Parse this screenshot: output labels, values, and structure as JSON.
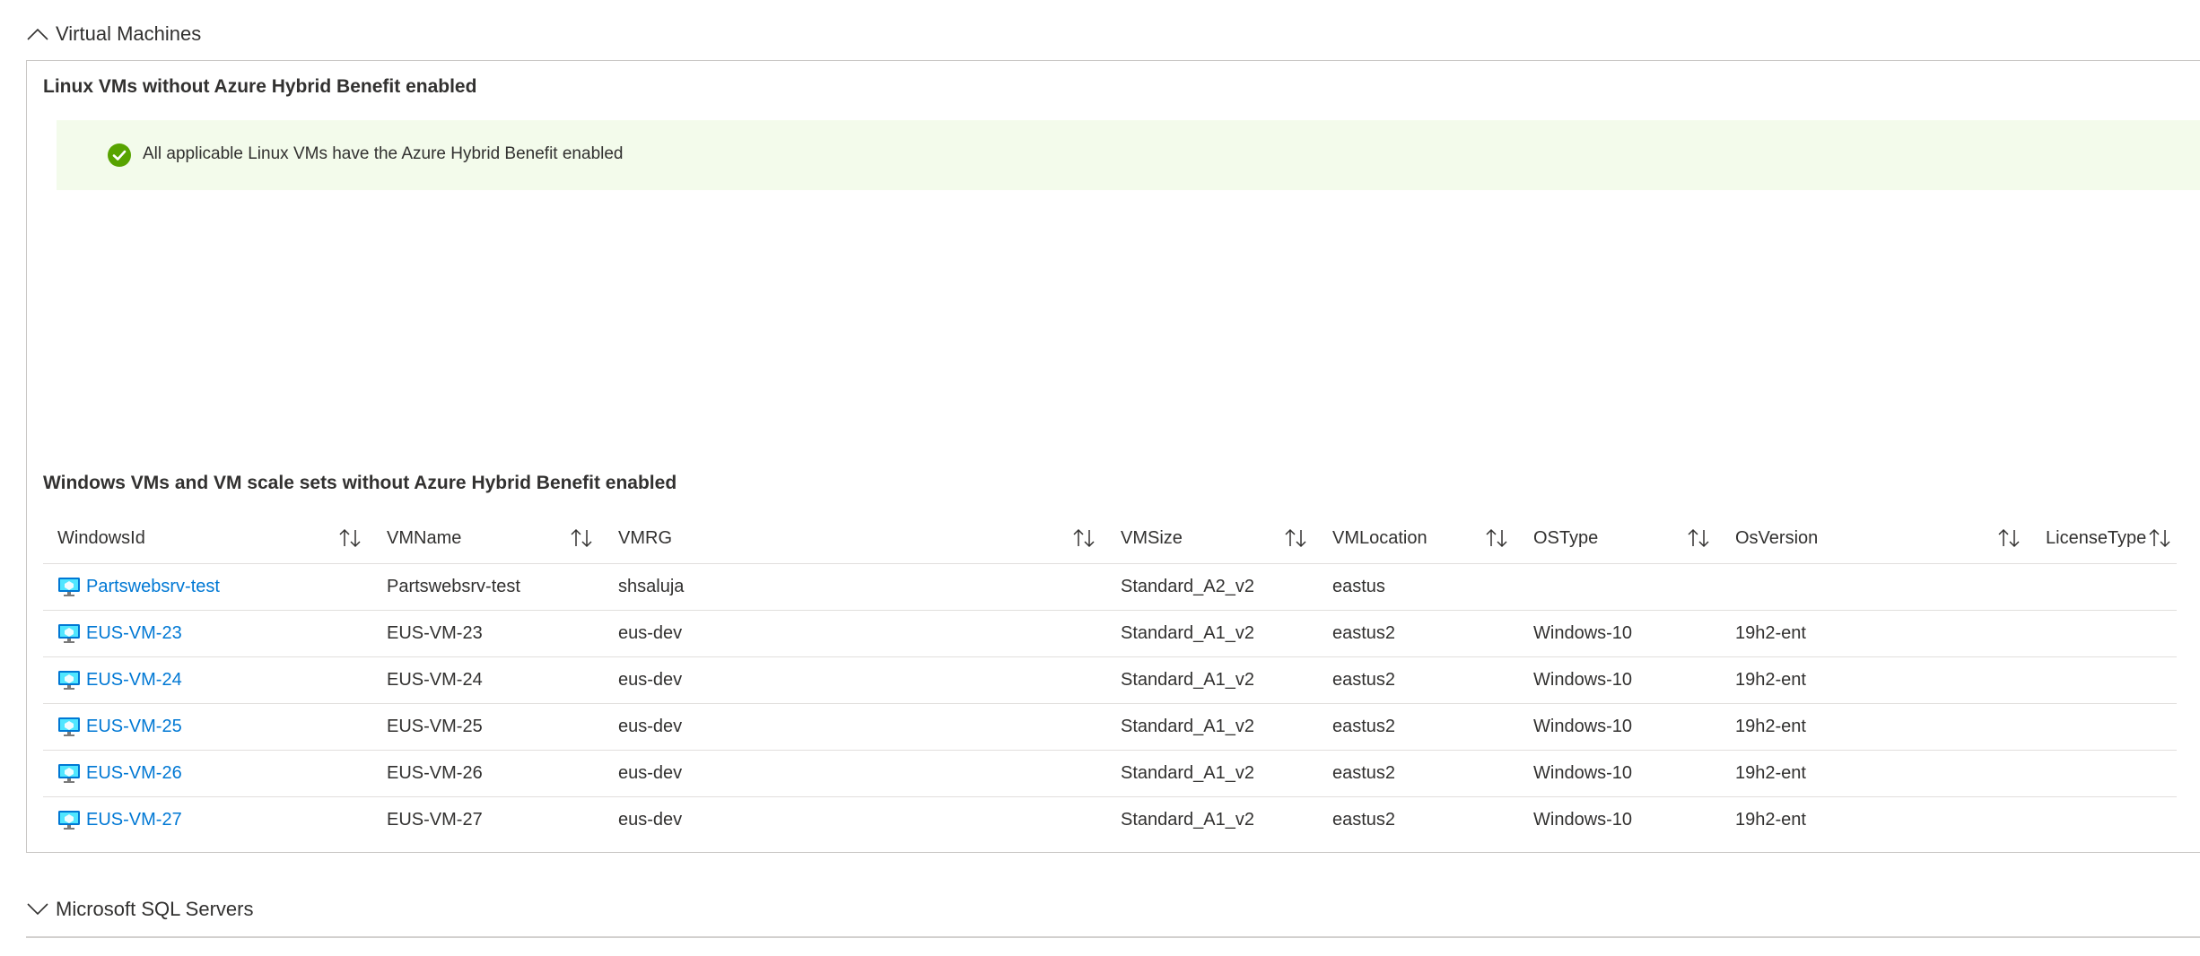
{
  "vm_section": {
    "title": "Virtual Machines",
    "expanded": true
  },
  "linux": {
    "title": "Linux VMs without Azure Hybrid Benefit enabled",
    "success_message": "All applicable Linux VMs have the Azure Hybrid Benefit enabled"
  },
  "windows": {
    "title": "Windows VMs and VM scale sets without Azure Hybrid Benefit enabled",
    "columns": [
      "WindowsId",
      "VMName",
      "VMRG",
      "VMSize",
      "VMLocation",
      "OSType",
      "OsVersion",
      "LicenseType"
    ],
    "rows": [
      {
        "id": "Partswebsrv-test",
        "name": "Partswebsrv-test",
        "rg": "shsaluja",
        "size": "Standard_A2_v2",
        "location": "eastus",
        "ostype": "",
        "osversion": "",
        "license": ""
      },
      {
        "id": "EUS-VM-23",
        "name": "EUS-VM-23",
        "rg": "eus-dev",
        "size": "Standard_A1_v2",
        "location": "eastus2",
        "ostype": "Windows-10",
        "osversion": "19h2-ent",
        "license": ""
      },
      {
        "id": "EUS-VM-24",
        "name": "EUS-VM-24",
        "rg": "eus-dev",
        "size": "Standard_A1_v2",
        "location": "eastus2",
        "ostype": "Windows-10",
        "osversion": "19h2-ent",
        "license": ""
      },
      {
        "id": "EUS-VM-25",
        "name": "EUS-VM-25",
        "rg": "eus-dev",
        "size": "Standard_A1_v2",
        "location": "eastus2",
        "ostype": "Windows-10",
        "osversion": "19h2-ent",
        "license": ""
      },
      {
        "id": "EUS-VM-26",
        "name": "EUS-VM-26",
        "rg": "eus-dev",
        "size": "Standard_A1_v2",
        "location": "eastus2",
        "ostype": "Windows-10",
        "osversion": "19h2-ent",
        "license": ""
      },
      {
        "id": "EUS-VM-27",
        "name": "EUS-VM-27",
        "rg": "eus-dev",
        "size": "Standard_A1_v2",
        "location": "eastus2",
        "ostype": "Windows-10",
        "osversion": "19h2-ent",
        "license": ""
      }
    ]
  },
  "sql_section": {
    "title": "Microsoft SQL Servers",
    "expanded": false
  },
  "colors": {
    "link": "#0078d4",
    "success_bg": "#f3fbeb",
    "success_icon": "#57a300",
    "border": "#c8c6c4",
    "text": "#323130"
  },
  "icons": {
    "section_expanded": "chevron-up-icon",
    "section_collapsed": "chevron-down-icon",
    "success": "check-circle-icon",
    "sort": "sort-arrows-icon",
    "vm": "virtual-machine-icon"
  }
}
